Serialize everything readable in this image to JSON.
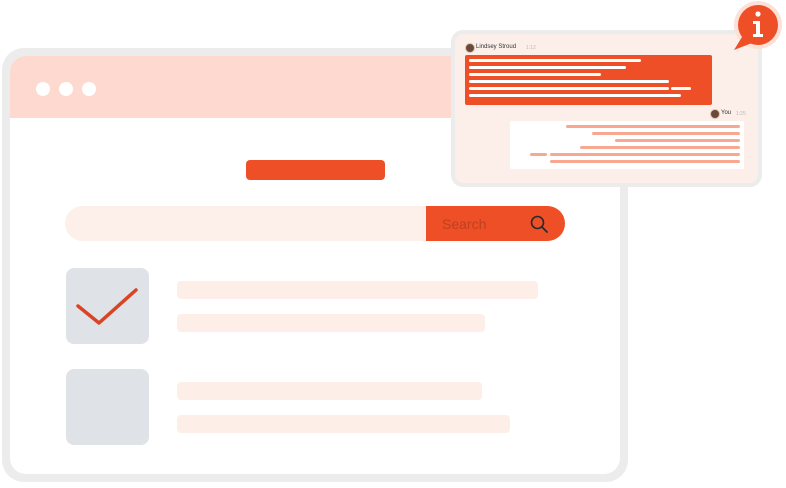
{
  "colors": {
    "accent": "#ee4f27",
    "titlebar": "#fdd9cf",
    "light_peach": "#fdefe9",
    "checkbox_gray": "#dfe3e8",
    "check_mark": "#d94426",
    "window_frame": "#ececec"
  },
  "window": {
    "controls": [
      "dot",
      "dot",
      "dot"
    ]
  },
  "search": {
    "placeholder": "",
    "button_label": "Search",
    "icon": "search-icon"
  },
  "tasks": [
    {
      "checked": true,
      "icon": "checkmark-icon"
    },
    {
      "checked": false
    }
  ],
  "chat": {
    "incoming": {
      "sender": "Lindsey Stroud",
      "time": "1:12"
    },
    "outgoing": {
      "sender": "You",
      "time": "1:25"
    },
    "notification_icon": "info-icon"
  }
}
